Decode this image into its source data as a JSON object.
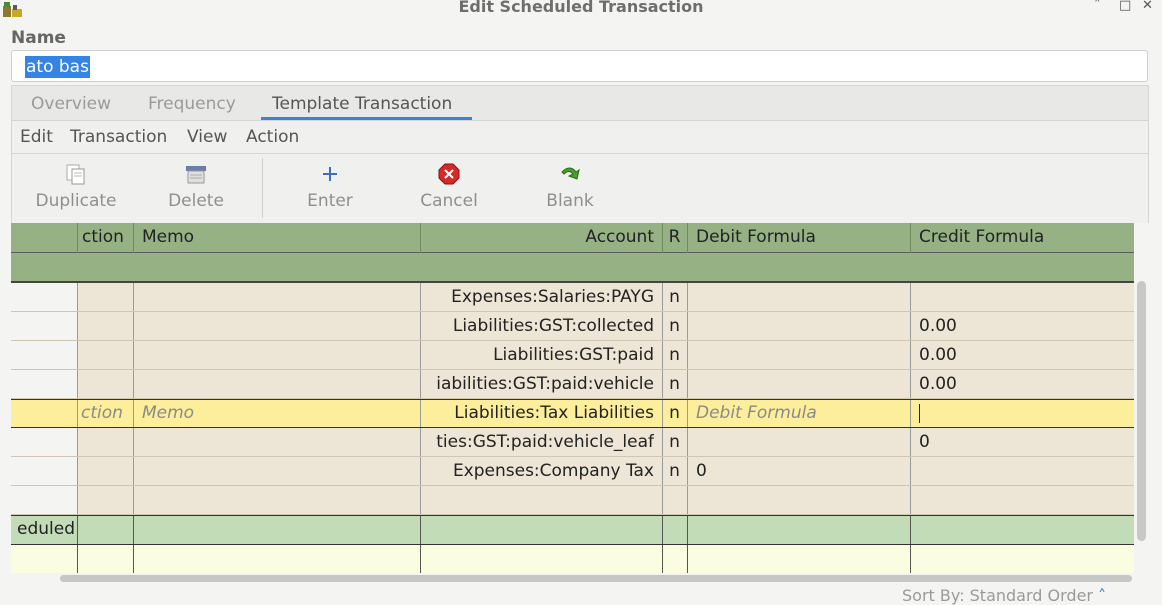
{
  "window": {
    "title": "Edit Scheduled Transaction"
  },
  "name": {
    "label": "Name",
    "value": "ato bas"
  },
  "tabs": [
    {
      "label": "Overview"
    },
    {
      "label": "Frequency"
    },
    {
      "label": "Template Transaction"
    }
  ],
  "menu": [
    "Edit",
    "Transaction",
    "View",
    "Action"
  ],
  "toolbar": {
    "duplicate": "Duplicate",
    "delete": "Delete",
    "enter": "Enter",
    "cancel": "Cancel",
    "blank": "Blank"
  },
  "register": {
    "columns": {
      "action": "ction",
      "memo": "Memo",
      "account": "Account",
      "r": "R",
      "debit": "Debit Formula",
      "credit": "Credit Formula"
    },
    "splits": [
      {
        "account": "Expenses:Salaries:PAYG",
        "r": "n",
        "debit": "",
        "credit": ""
      },
      {
        "account": "Liabilities:GST:collected",
        "r": "n",
        "debit": "",
        "credit": "0.00"
      },
      {
        "account": "Liabilities:GST:paid",
        "r": "n",
        "debit": "",
        "credit": "0.00"
      },
      {
        "account": "iabilities:GST:paid:vehicle",
        "r": "n",
        "debit": "",
        "credit": "0.00"
      },
      {
        "account": "Liabilities:Tax Liabilities",
        "r": "n",
        "debit": "Debit Formula",
        "credit": "",
        "action": "ction",
        "memo": "Memo",
        "active": true
      },
      {
        "account": "ties:GST:paid:vehicle_leaf",
        "r": "n",
        "debit": "",
        "credit": "0"
      },
      {
        "account": "Expenses:Company Tax",
        "r": "n",
        "debit": "0",
        "credit": ""
      },
      {
        "account": "",
        "r": "",
        "debit": "",
        "credit": ""
      }
    ],
    "scheduled_label": "eduled"
  },
  "status": {
    "sort": "Sort By: Standard Order"
  },
  "colors": {
    "header": "#96b183",
    "split_row": "#ede5d5",
    "active_row": "#fcee9a",
    "txn_row": "#c2dcb7",
    "blank_row": "#fbfde0",
    "accent": "#3584e4"
  }
}
